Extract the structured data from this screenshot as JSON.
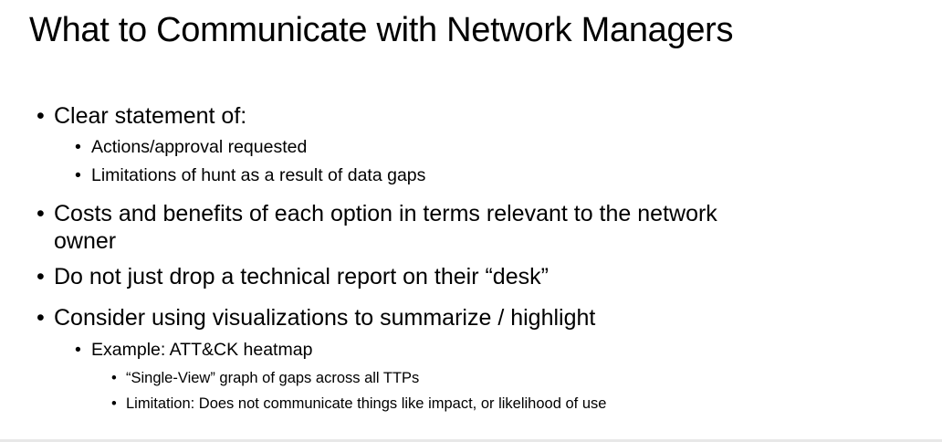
{
  "slide": {
    "title": "What to Communicate with Network Managers",
    "bullet_char": "•",
    "items": [
      {
        "text": "Clear statement of:",
        "children": [
          {
            "text": "Actions/approval requested"
          },
          {
            "text": "Limitations of hunt as a result of data gaps"
          }
        ]
      },
      {
        "text": "Costs and benefits of each option in terms relevant to the network",
        "continuation": "owner"
      },
      {
        "text": "Do not just drop a technical report on their “desk”"
      },
      {
        "text": "Consider using visualizations to summarize / highlight",
        "children": [
          {
            "text": "Example: ATT&CK heatmap",
            "children": [
              {
                "text": "“Single-View” graph of gaps across all TTPs"
              },
              {
                "text": "Limitation: Does not communicate things like impact, or likelihood of use"
              }
            ]
          }
        ]
      }
    ]
  }
}
